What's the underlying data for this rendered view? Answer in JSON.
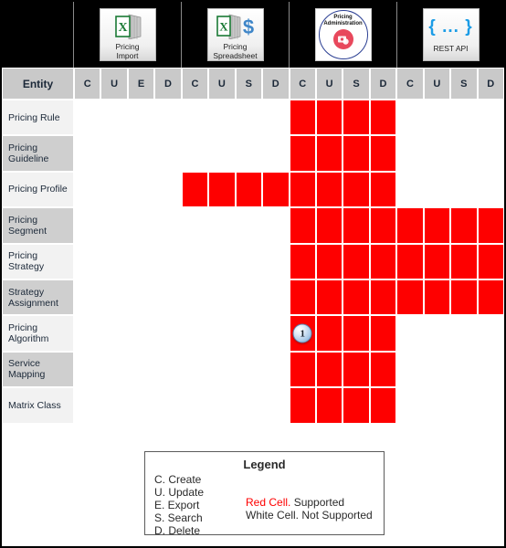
{
  "appbar": {
    "apps": [
      {
        "name": "Pricing Import",
        "label_line1": "Pricing",
        "label_line2": "Import",
        "icon": "excel-document-icon"
      },
      {
        "name": "Pricing Spreadsheet",
        "label_line1": "Pricing",
        "label_line2": "Spreadsheet",
        "icon": "excel-dollar-icon"
      },
      {
        "name": "Pricing Administration",
        "label_line1": "Pricing",
        "label_line2": "Administration",
        "icon": "pricing-administration-badge-icon"
      },
      {
        "name": "REST API",
        "label_line1": "REST API",
        "label_line2": "",
        "icon": "curly-braces-icon",
        "art": "{ ... }"
      }
    ]
  },
  "header": {
    "entity_label": "Entity",
    "operations": [
      "C",
      "U",
      "E",
      "D",
      "C",
      "U",
      "S",
      "D",
      "C",
      "U",
      "S",
      "D",
      "C",
      "U",
      "S",
      "D"
    ]
  },
  "matrix": {
    "rows": [
      {
        "entity": "Pricing Rule",
        "cells": [
          0,
          0,
          0,
          0,
          0,
          0,
          0,
          0,
          1,
          1,
          1,
          1,
          0,
          0,
          0,
          0
        ]
      },
      {
        "entity": "Pricing Guideline",
        "cells": [
          0,
          0,
          0,
          0,
          0,
          0,
          0,
          0,
          1,
          1,
          1,
          1,
          0,
          0,
          0,
          0
        ]
      },
      {
        "entity": "Pricing Profile",
        "cells": [
          0,
          0,
          0,
          0,
          1,
          1,
          1,
          1,
          1,
          1,
          1,
          1,
          0,
          0,
          0,
          0
        ]
      },
      {
        "entity": "Pricing Segment",
        "cells": [
          0,
          0,
          0,
          0,
          0,
          0,
          0,
          0,
          1,
          1,
          1,
          1,
          1,
          1,
          1,
          1
        ]
      },
      {
        "entity": "Pricing Strategy",
        "cells": [
          0,
          0,
          0,
          0,
          0,
          0,
          0,
          0,
          1,
          1,
          1,
          1,
          1,
          1,
          1,
          1
        ]
      },
      {
        "entity": "Strategy Assignment",
        "cells": [
          0,
          0,
          0,
          0,
          0,
          0,
          0,
          0,
          1,
          1,
          1,
          1,
          1,
          1,
          1,
          1
        ]
      },
      {
        "entity": "Pricing Algorithm",
        "cells": [
          0,
          0,
          0,
          0,
          0,
          0,
          0,
          0,
          1,
          1,
          1,
          1,
          0,
          0,
          0,
          0
        ]
      },
      {
        "entity": "Service Mapping",
        "cells": [
          0,
          0,
          0,
          0,
          0,
          0,
          0,
          0,
          1,
          1,
          1,
          1,
          0,
          0,
          0,
          0
        ]
      },
      {
        "entity": "Matrix Class",
        "cells": [
          0,
          0,
          0,
          0,
          0,
          0,
          0,
          0,
          1,
          1,
          1,
          1,
          0,
          0,
          0,
          0
        ]
      }
    ],
    "markers": [
      {
        "label": "1",
        "row": 6,
        "col": 8
      }
    ]
  },
  "legend": {
    "title": "Legend",
    "keys": [
      "C. Create",
      "U. Update",
      "E. Export",
      "S. Search",
      "D. Delete"
    ],
    "red_key": "Red Cell.",
    "red_meaning": " Supported",
    "white_line": "White Cell. Not Supported"
  },
  "colors": {
    "supported": "#fe0000",
    "not_supported": "#ffffff",
    "header_bg": "#c9c9c9",
    "appbar_bg": "#000000"
  }
}
